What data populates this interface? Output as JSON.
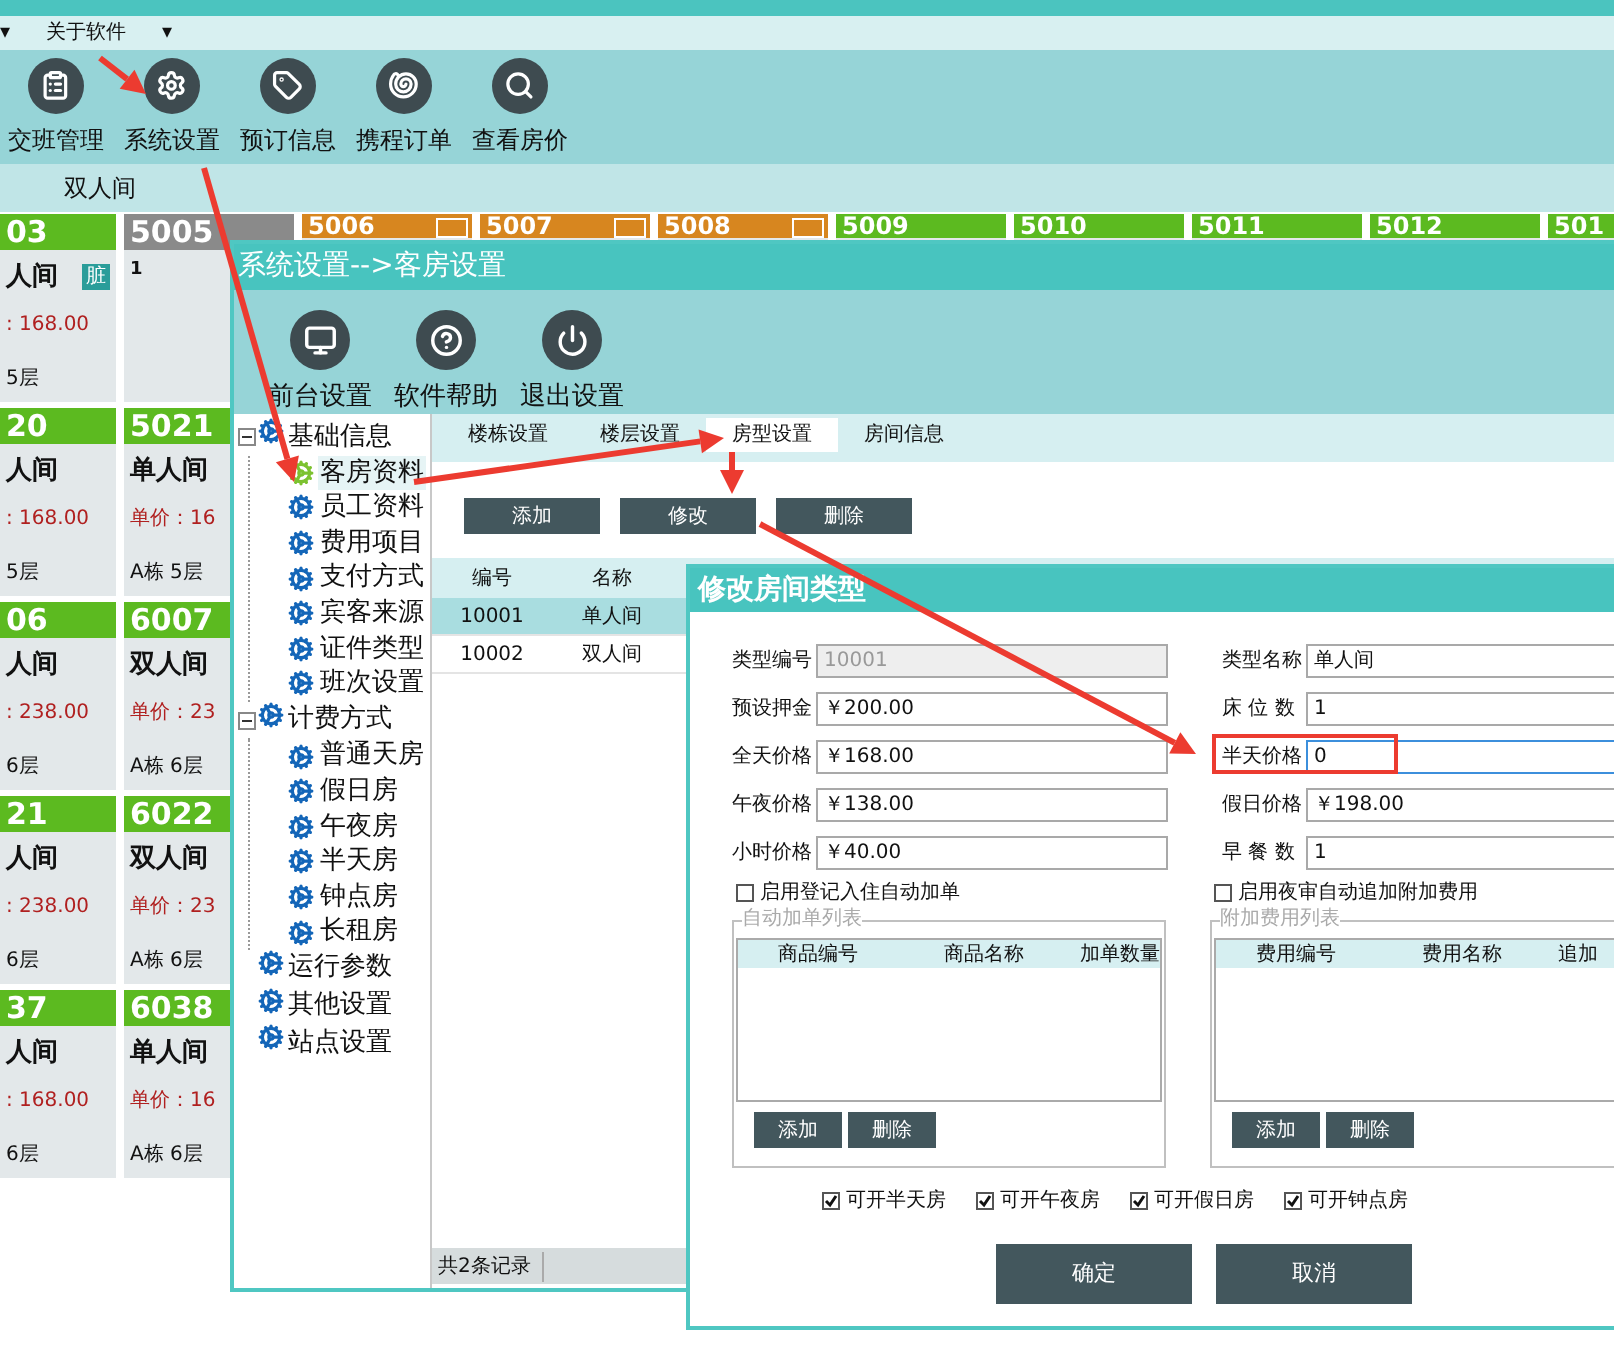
{
  "menu_bar": [
    "▾",
    "关于软件",
    "▾"
  ],
  "toolbar": [
    {
      "label": "交班管理",
      "kind": "shift"
    },
    {
      "label": "系统设置",
      "kind": "settings"
    },
    {
      "label": "预订信息",
      "kind": "booking"
    },
    {
      "label": "携程订单",
      "kind": "ctrip"
    },
    {
      "label": "查看房价",
      "kind": "price"
    }
  ],
  "filter_label": "双人间",
  "room_rows": [
    {
      "cards": [
        {
          "number": "03",
          "color": "#5cba20",
          "flag": false,
          "room_type": "人间",
          "badge": "脏",
          "price": ": 168.00",
          "floor": "5层"
        },
        {
          "number": "5005",
          "color": "#8a8a8a",
          "flag": false,
          "note": "1"
        },
        {
          "number": "5006",
          "color": "#d7861f",
          "flag": true
        },
        {
          "number": "5007",
          "color": "#d7861f",
          "flag": true
        },
        {
          "number": "5008",
          "color": "#d7861f",
          "flag": true
        },
        {
          "number": "5009",
          "color": "#5cba20",
          "flag": false
        },
        {
          "number": "5010",
          "color": "#5cba20",
          "flag": false
        },
        {
          "number": "5011",
          "color": "#5cba20",
          "flag": false
        },
        {
          "number": "5012",
          "color": "#5cba20",
          "flag": false
        },
        {
          "number": "501",
          "color": "#5cba20",
          "flag": false
        }
      ]
    },
    {
      "cards": [
        {
          "number": "20",
          "color": "#5cba20",
          "flag": false,
          "room_type": "人间",
          "price": ": 168.00",
          "floor": "5层"
        },
        {
          "number": "5021",
          "color": "#5cba20",
          "flag": false,
          "room_type": "单人间",
          "price": "单价：16",
          "floor": "A栋 5层"
        }
      ]
    },
    {
      "cards": [
        {
          "number": "06",
          "color": "#5cba20",
          "flag": false,
          "room_type": "人间",
          "price": ": 238.00",
          "floor": "6层"
        },
        {
          "number": "6007",
          "color": "#5cba20",
          "flag": false,
          "room_type": "双人间",
          "price": "单价：23",
          "floor": "A栋 6层"
        }
      ]
    },
    {
      "cards": [
        {
          "number": "21",
          "color": "#5cba20",
          "flag": false,
          "room_type": "人间",
          "price": ": 238.00",
          "floor": "6层"
        },
        {
          "number": "6022",
          "color": "#5cba20",
          "flag": false,
          "room_type": "双人间",
          "price": "单价：23",
          "floor": "A栋 6层"
        }
      ]
    },
    {
      "cards": [
        {
          "number": "37",
          "color": "#5cba20",
          "flag": false,
          "room_type": "人间",
          "price": ": 168.00",
          "floor": "6层"
        },
        {
          "number": "6038",
          "color": "#5cba20",
          "flag": false,
          "room_type": "单人间",
          "price": "单价：16",
          "floor": "A栋 6层"
        }
      ]
    }
  ],
  "settings_window": {
    "title": "系统设置-->客房设置",
    "toolbar": [
      {
        "label": "前台设置",
        "kind": "monitor"
      },
      {
        "label": "软件帮助",
        "kind": "help"
      },
      {
        "label": "退出设置",
        "kind": "power"
      }
    ],
    "tree": [
      {
        "label": "基础信息",
        "expanded": true,
        "selected": false,
        "children": [
          {
            "label": "客房资料",
            "selected": true
          },
          {
            "label": "员工资料",
            "selected": false
          },
          {
            "label": "费用项目",
            "selected": false
          },
          {
            "label": "支付方式",
            "selected": false
          },
          {
            "label": "宾客来源",
            "selected": false
          },
          {
            "label": "证件类型",
            "selected": false
          },
          {
            "label": "班次设置",
            "selected": false
          }
        ]
      },
      {
        "label": "计费方式",
        "expanded": true,
        "selected": false,
        "children": [
          {
            "label": "普通天房",
            "selected": false
          },
          {
            "label": "假日房",
            "selected": false
          },
          {
            "label": "午夜房",
            "selected": false
          },
          {
            "label": "半天房",
            "selected": false
          },
          {
            "label": "钟点房",
            "selected": false
          },
          {
            "label": "长租房",
            "selected": false
          }
        ]
      },
      {
        "label": "运行参数",
        "expanded": false,
        "selected": false
      },
      {
        "label": "其他设置",
        "expanded": false,
        "selected": false
      },
      {
        "label": "站点设置",
        "expanded": false,
        "selected": false
      }
    ],
    "tabs": [
      {
        "label": "楼栋设置",
        "selected": false
      },
      {
        "label": "楼层设置",
        "selected": false
      },
      {
        "label": "房型设置",
        "selected": true
      },
      {
        "label": "房间信息",
        "selected": false
      }
    ],
    "buttons": [
      "添加",
      "修改",
      "删除"
    ],
    "table": {
      "columns": [
        "编号",
        "名称"
      ],
      "rows": [
        {
          "cells": [
            "10001",
            "单人间"
          ],
          "selected": true
        },
        {
          "cells": [
            "10002",
            "双人间"
          ],
          "selected": false
        }
      ]
    },
    "status": "共2条记录"
  },
  "dialog": {
    "title": "修改房间类型",
    "fields_left": [
      {
        "label": "类型编号",
        "value": "10001",
        "disabled": true,
        "focused": false
      },
      {
        "label": "预设押金",
        "value": "￥200.00",
        "disabled": false,
        "focused": false
      },
      {
        "label": "全天价格",
        "value": "￥168.00",
        "disabled": false,
        "focused": false
      },
      {
        "label": "午夜价格",
        "value": "￥138.00",
        "disabled": false,
        "focused": false
      },
      {
        "label": "小时价格",
        "value": "￥40.00",
        "disabled": false,
        "focused": false
      }
    ],
    "fields_right": [
      {
        "label": "类型名称",
        "value": "单人间",
        "disabled": false,
        "focused": false
      },
      {
        "label": "床 位 数",
        "value": "1",
        "disabled": false,
        "focused": false
      },
      {
        "label": "半天价格",
        "value": "0",
        "disabled": false,
        "focused": true
      },
      {
        "label": "假日价格",
        "value": "￥198.00",
        "disabled": false,
        "focused": false
      },
      {
        "label": "早 餐 数",
        "value": "1",
        "disabled": false,
        "focused": false
      }
    ],
    "groups": [
      {
        "checkbox": {
          "label": "启用登记入住自动加单",
          "checked": false
        },
        "title": "自动加单列表",
        "columns": [
          "商品编号",
          "商品名称",
          "加单数量"
        ],
        "buttons": [
          "添加",
          "删除"
        ]
      },
      {
        "checkbox": {
          "label": "启用夜审自动追加附加费用",
          "checked": false
        },
        "title": "附加费用列表",
        "columns": [
          "费用编号",
          "费用名称",
          "追加"
        ],
        "buttons": [
          "添加",
          "删除"
        ]
      }
    ],
    "options": [
      {
        "label": "可开半天房",
        "checked": true
      },
      {
        "label": "可开午夜房",
        "checked": true
      },
      {
        "label": "可开假日房",
        "checked": true
      },
      {
        "label": "可开钟点房",
        "checked": true
      }
    ],
    "actions": [
      "确定",
      "取消"
    ]
  }
}
